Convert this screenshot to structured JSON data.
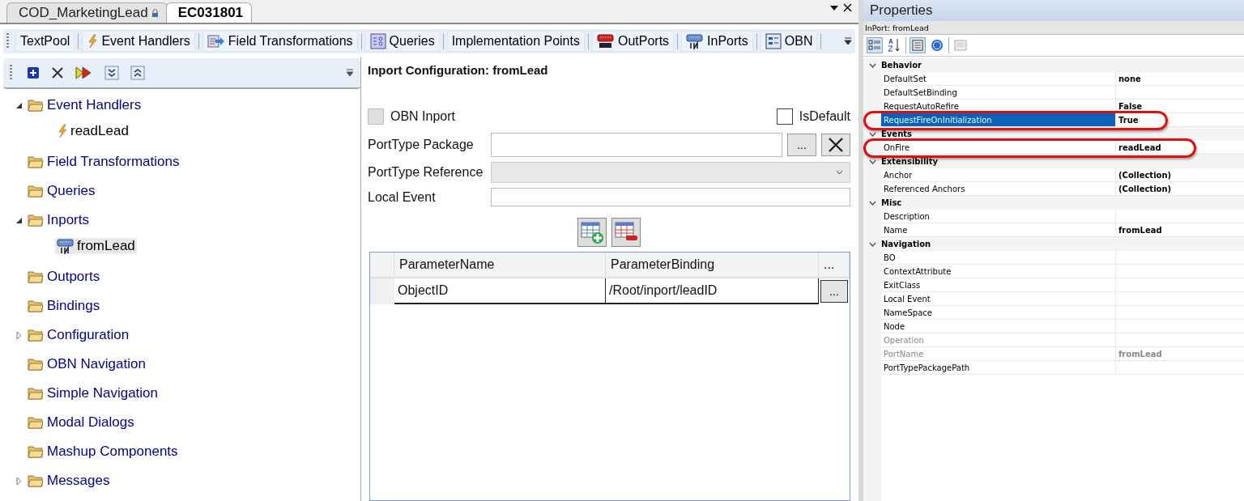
{
  "doc_tabs": [
    {
      "label": "COD_MarketingLead",
      "selected": false,
      "locked": true
    },
    {
      "label": "EC031801",
      "selected": true,
      "locked": false
    }
  ],
  "toolbar": {
    "items": [
      {
        "label": "TextPool",
        "kind": "text"
      },
      {
        "label": "Event Handlers",
        "kind": "lightning"
      },
      {
        "label": "Field Transformations",
        "kind": "transform"
      },
      {
        "label": "Queries",
        "kind": "queries"
      },
      {
        "label": "Implementation Points",
        "kind": "text"
      },
      {
        "label": "OutPorts",
        "kind": "outport"
      },
      {
        "label": "InPorts",
        "kind": "inport"
      },
      {
        "label": "OBN",
        "kind": "obn"
      }
    ]
  },
  "tree": [
    {
      "label": "Event Handlers",
      "expanded": true,
      "children": [
        {
          "label": "readLead",
          "kind": "handler",
          "selected": false
        }
      ]
    },
    {
      "label": "Field Transformations"
    },
    {
      "label": "Queries"
    },
    {
      "label": "Inports",
      "expanded": true,
      "children": [
        {
          "label": "fromLead",
          "kind": "inport",
          "selected": true
        }
      ]
    },
    {
      "label": "Outports"
    },
    {
      "label": "Bindings"
    },
    {
      "label": "Configuration",
      "expanded": false
    },
    {
      "label": "OBN Navigation"
    },
    {
      "label": "Simple Navigation"
    },
    {
      "label": "Modal Dialogs"
    },
    {
      "label": "Mashup Components"
    },
    {
      "label": "Messages",
      "expanded": false
    }
  ],
  "config": {
    "title": "Inport Configuration: fromLead",
    "obn_inport": {
      "label": "OBN Inport",
      "checked": false,
      "disabled": true
    },
    "is_default": {
      "label": "IsDefault",
      "checked": false,
      "disabled": false
    },
    "port_type_package": {
      "label": "PortType Package",
      "browse": "..."
    },
    "port_type_reference": {
      "label": "PortType Reference"
    },
    "local_event": {
      "label": "Local Event"
    },
    "grid": {
      "columns": [
        "ParameterName",
        "ParameterBinding",
        "..."
      ],
      "rows": [
        {
          "cells": [
            "ObjectID",
            "/Root/inport/leadID"
          ],
          "button": "..."
        }
      ]
    }
  },
  "properties": {
    "title": "Properties",
    "subject": "InPort: fromLead",
    "categories": [
      {
        "name": "Behavior",
        "expanded": true,
        "rows": [
          {
            "name": "DefaultSet",
            "value": "none",
            "selected": false,
            "highlighted": false,
            "disabled": false
          },
          {
            "name": "DefaultSetBinding",
            "selected": false,
            "highlighted": false,
            "disabled": false
          },
          {
            "name": "RequestAutoRefire",
            "value": "False",
            "selected": false,
            "highlighted": false,
            "disabled": false
          },
          {
            "name": "RequestFireOnInitialization",
            "value": "True",
            "selected": true,
            "highlighted": true,
            "disabled": false
          }
        ]
      },
      {
        "name": "Events",
        "expanded": true,
        "rows": [
          {
            "name": "OnFire",
            "value": "readLead",
            "selected": false,
            "highlighted": true,
            "disabled": false
          }
        ]
      },
      {
        "name": "Extensibility",
        "expanded": true,
        "rows": [
          {
            "name": "Anchor",
            "value": "(Collection)",
            "selected": false,
            "highlighted": false,
            "disabled": false
          },
          {
            "name": "Referenced Anchors",
            "value": "(Collection)",
            "selected": false,
            "highlighted": false,
            "disabled": false
          }
        ]
      },
      {
        "name": "Misc",
        "expanded": true,
        "rows": [
          {
            "name": "Description",
            "selected": false,
            "highlighted": false,
            "disabled": false
          },
          {
            "name": "Name",
            "value": "fromLead",
            "selected": false,
            "highlighted": false,
            "disabled": false
          }
        ]
      },
      {
        "name": "Navigation",
        "expanded": true,
        "rows": [
          {
            "name": "BO",
            "selected": false,
            "highlighted": false,
            "disabled": false
          },
          {
            "name": "ContextAttribute",
            "selected": false,
            "highlighted": false,
            "disabled": false
          },
          {
            "name": "ExitClass",
            "selected": false,
            "highlighted": false,
            "disabled": false
          },
          {
            "name": "Local Event",
            "selected": false,
            "highlighted": false,
            "disabled": false
          },
          {
            "name": "NameSpace",
            "selected": false,
            "highlighted": false,
            "disabled": false
          },
          {
            "name": "Node",
            "selected": false,
            "highlighted": false,
            "disabled": false
          },
          {
            "name": "Operation",
            "selected": false,
            "highlighted": false,
            "disabled": true
          },
          {
            "name": "PortName",
            "value": "fromLead",
            "selected": false,
            "highlighted": false,
            "disabled": true
          },
          {
            "name": "PortTypePackagePath",
            "selected": false,
            "highlighted": false,
            "disabled": false
          }
        ]
      }
    ]
  }
}
